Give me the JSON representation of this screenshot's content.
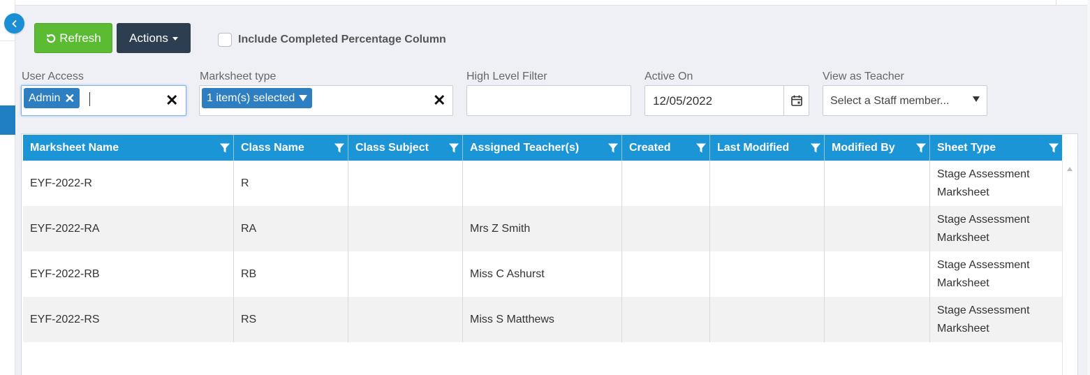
{
  "toolbar": {
    "refresh_label": "Refresh",
    "actions_label": "Actions",
    "include_completed_label": "Include Completed Percentage Column"
  },
  "filters": {
    "user_access": {
      "label": "User Access",
      "chip": "Admin"
    },
    "marksheet_type": {
      "label": "Marksheet type",
      "chip": "1 item(s) selected"
    },
    "high_level": {
      "label": "High Level Filter",
      "value": ""
    },
    "active_on": {
      "label": "Active On",
      "value": "12/05/2022"
    },
    "view_as_teacher": {
      "label": "View as Teacher",
      "placeholder": "Select a Staff member..."
    }
  },
  "grid": {
    "columns": [
      "Marksheet Name",
      "Class Name",
      "Class Subject",
      "Assigned Teacher(s)",
      "Created",
      "Last Modified",
      "Modified By",
      "Sheet Type"
    ],
    "rows": [
      {
        "name": "EYF-2022-R",
        "class": "R",
        "subject": "",
        "teacher": "",
        "created": "",
        "modified": "",
        "modified_by": "",
        "sheet_type_1": "Stage Assessment",
        "sheet_type_2": "Marksheet"
      },
      {
        "name": "EYF-2022-RA",
        "class": "RA",
        "subject": "",
        "teacher": "Mrs Z Smith",
        "created": "",
        "modified": "",
        "modified_by": "",
        "sheet_type_1": "Stage Assessment",
        "sheet_type_2": "Marksheet"
      },
      {
        "name": "EYF-2022-RB",
        "class": "RB",
        "subject": "",
        "teacher": "Miss C Ashurst",
        "created": "",
        "modified": "",
        "modified_by": "",
        "sheet_type_1": "Stage Assessment",
        "sheet_type_2": "Marksheet"
      },
      {
        "name": "EYF-2022-RS",
        "class": "RS",
        "subject": "",
        "teacher": "Miss S Matthews",
        "created": "",
        "modified": "",
        "modified_by": "",
        "sheet_type_1": "Stage Assessment",
        "sheet_type_2": "Marksheet"
      }
    ]
  },
  "colors": {
    "refresh": "#5bbb32",
    "actions": "#2c3e50",
    "header": "#1b95d6",
    "chip": "#2e7fc2"
  }
}
